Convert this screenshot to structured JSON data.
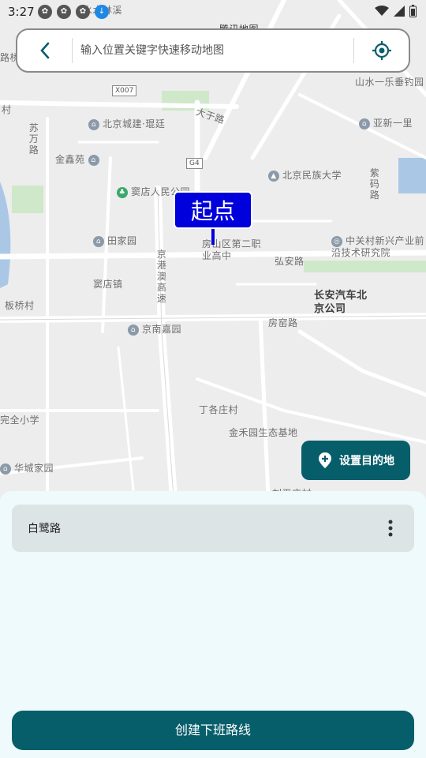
{
  "status_bar": {
    "time": "3:27"
  },
  "search": {
    "placeholder": "输入位置关键字快速移动地图"
  },
  "map": {
    "labels": {
      "shuilinxi": "水木林溪",
      "tengxunditu": "腾讯地图",
      "luqiao": "路桥",
      "shanshuiyile": "山水一乐垂钓园",
      "x007": "X007",
      "cun": "村",
      "suwanlu": "苏万路",
      "dayulu": "大于路",
      "beijingchengjian": "北京城建·琨廷",
      "yaxinyili": "亚新一里",
      "jinxinyuan": "金鑫苑",
      "g4": "G4",
      "beijingminzu": "北京民族大学",
      "zimalu": "紫码路",
      "doudianrenmin": "窦店人民公园",
      "tianjiayuan": "田家园",
      "fangshanqu": "房山区第二职业高中",
      "hongan": "弘安路",
      "zhongguancun": "中关村新兴产业前沿技术研究院",
      "jinggangao": "京港澳高速",
      "doudianzhen": "窦店镇",
      "changan": "长安汽车北京公司",
      "banqiaocun": "板桥村",
      "jingnanjiayuan": "京南嘉园",
      "fangyaolu": "房窑路",
      "dinggezhuang": "丁各庄村",
      "wanquan": "完全小学",
      "jinheyuan": "金禾园生态基地",
      "huachengjiayuan": "华城家园",
      "liupingzhuang": "刘平庄村"
    },
    "start_marker": "起点",
    "set_destination_label": "设置目的地"
  },
  "routes": [
    {
      "name": "白鹭路"
    }
  ],
  "create_button_label": "创建下班路线",
  "colors": {
    "accent": "#075e6b",
    "marker": "#0000dd",
    "sheet_bg": "#eefafb"
  }
}
